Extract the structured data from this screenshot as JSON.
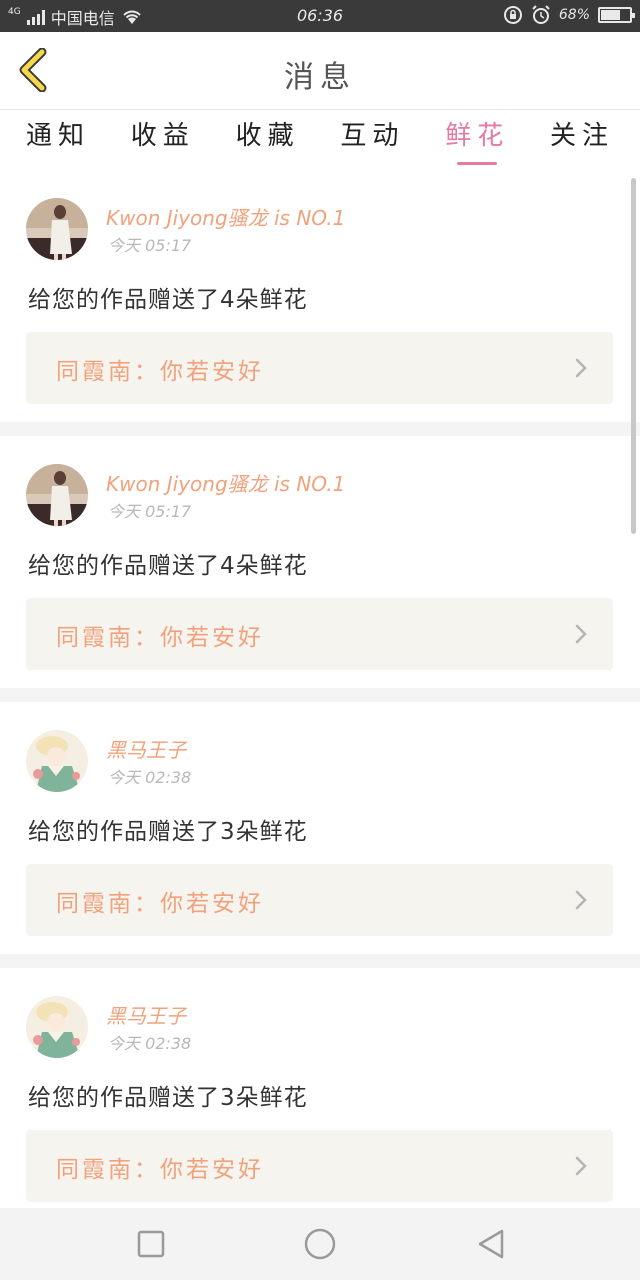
{
  "status_bar": {
    "network": "4G",
    "carrier": "中国电信",
    "time": "06:36",
    "battery": "68%",
    "battery_level": 0.68,
    "icons": [
      "signal-icon",
      "wifi-icon",
      "lock-rotation-icon",
      "alarm-icon",
      "battery-icon"
    ]
  },
  "header": {
    "title": "消息",
    "back_icon": "chevron-left-icon",
    "accent_color": "#f5d94a"
  },
  "tabs": [
    {
      "label": "通知",
      "active": false
    },
    {
      "label": "收益",
      "active": false
    },
    {
      "label": "收藏",
      "active": false
    },
    {
      "label": "互动",
      "active": false
    },
    {
      "label": "鲜花",
      "active": true
    },
    {
      "label": "关注",
      "active": false
    }
  ],
  "active_color": "#e57aa2",
  "messages": [
    {
      "username": "Kwon Jiyong骚龙 is NO.1",
      "time": "今天 05:17",
      "message": "给您的作品赠送了4朵鲜花",
      "quote": "同霞南：你若安好",
      "avatar": "photo-avatar"
    },
    {
      "username": "Kwon Jiyong骚龙 is NO.1",
      "time": "今天 05:17",
      "message": "给您的作品赠送了4朵鲜花",
      "quote": "同霞南：你若安好",
      "avatar": "photo-avatar"
    },
    {
      "username": "黑马王子",
      "time": "今天 02:38",
      "message": "给您的作品赠送了3朵鲜花",
      "quote": "同霞南：你若安好",
      "avatar": "illustration-avatar"
    },
    {
      "username": "黑马王子",
      "time": "今天 02:38",
      "message": "给您的作品赠送了3朵鲜花",
      "quote": "同霞南：你若安好",
      "avatar": "illustration-avatar"
    }
  ],
  "nav_bar": {
    "icons": [
      "recent-apps-icon",
      "home-icon",
      "back-triangle-icon"
    ]
  }
}
